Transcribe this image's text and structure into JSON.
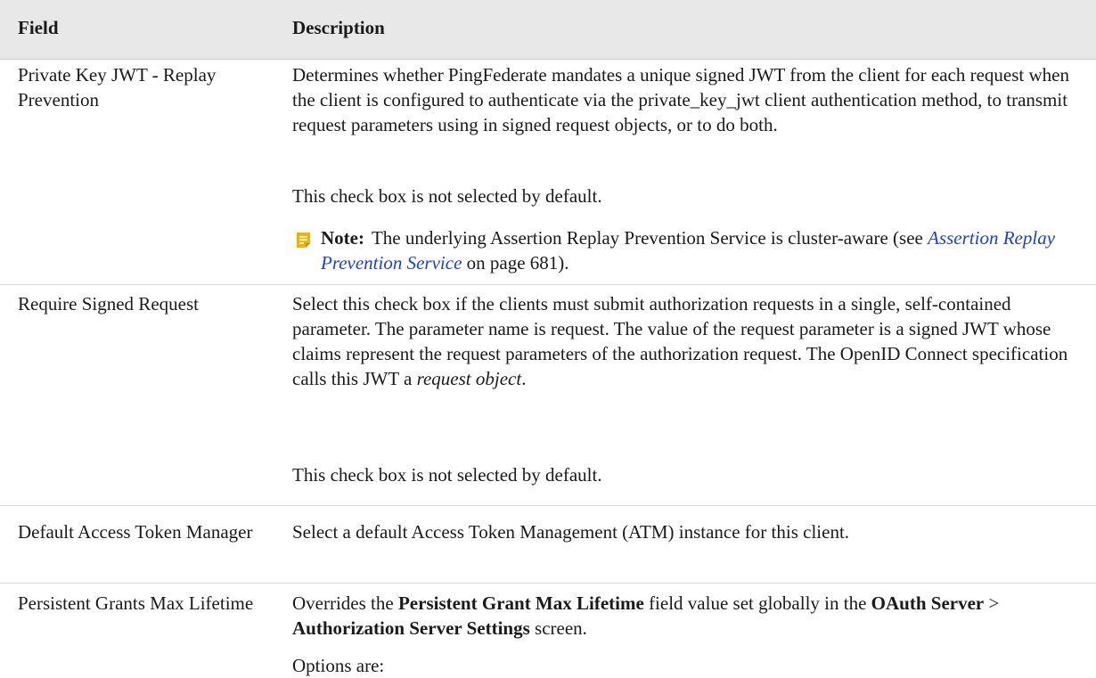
{
  "table": {
    "header": {
      "field": "Field",
      "description": "Description"
    },
    "rows": [
      {
        "field": "Private Key JWT - Replay Prevention",
        "para1": "Determines whether PingFederate mandates a unique signed JWT from the client for each request when the client is configured to authenticate via the private_key_jwt client authentication method, to transmit request parameters using in signed request objects, or to do both.",
        "para2": "This check box is not selected by default.",
        "note": {
          "label": "Note:",
          "text_before": "The underlying Assertion Replay Prevention Service is cluster-aware (see ",
          "link": "Assertion Replay Prevention Service",
          "text_after": " on page 681)."
        }
      },
      {
        "field": "Require Signed Request",
        "para1_a": "Select this check box if the clients must submit authorization requests in a single, self-contained parameter. The parameter name is request. The value of the request parameter is a signed JWT whose claims represent the request parameters of the authorization request. The OpenID Connect specification calls this JWT a ",
        "para1_em": "request object",
        "para1_b": ".",
        "para2": "This check box is not selected by default."
      },
      {
        "field": "Default Access Token Manager",
        "para1": "Select a default Access Token Management (ATM) instance for this client."
      },
      {
        "field": "Persistent Grants Max Lifetime",
        "p1_a": "Overrides the ",
        "p1_b1": "Persistent Grant Max Lifetime",
        "p1_c": " field value set globally in the ",
        "p1_b2": "OAuth Server",
        "p1_d": " > ",
        "p1_b3": "Authorization Server Settings",
        "p1_e": " screen.",
        "para2": "Options are:"
      }
    ]
  },
  "icons": {
    "note": "note-icon"
  },
  "colors": {
    "link": "#1a3fd8",
    "note_icon": "#f0b400",
    "header_bg": "#e8e8e8"
  }
}
